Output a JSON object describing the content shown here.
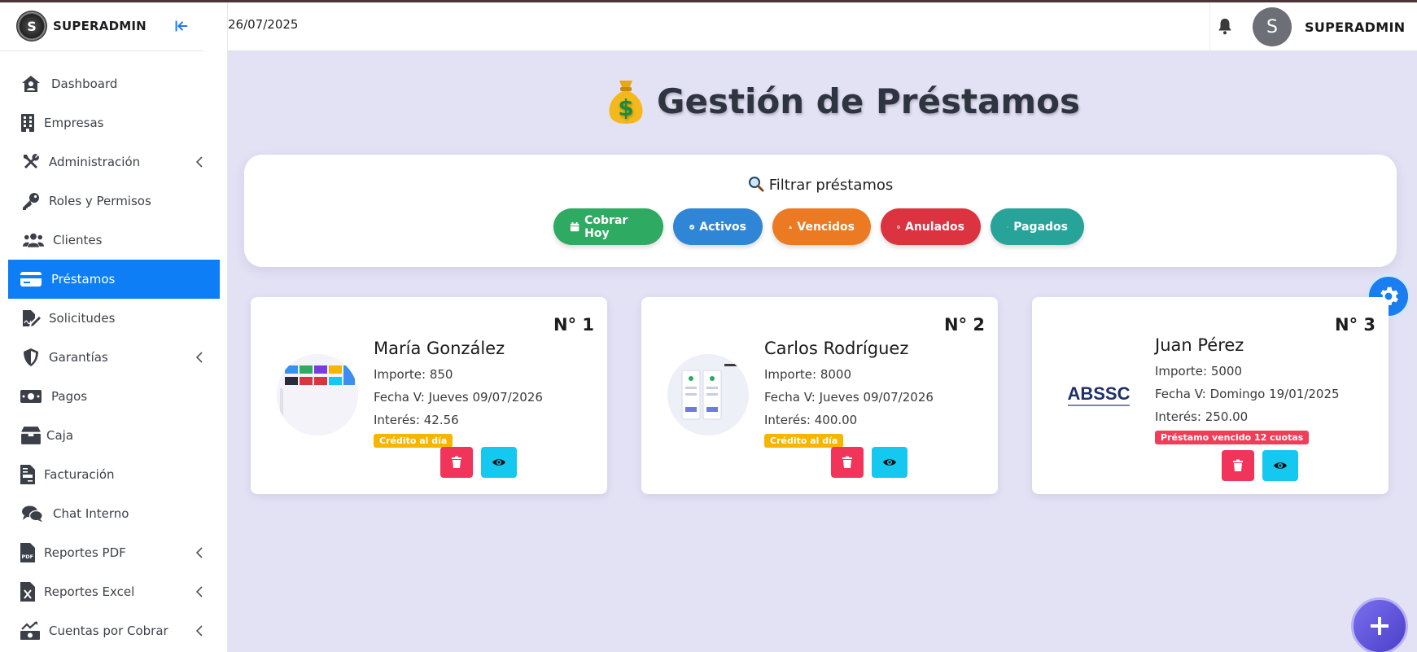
{
  "app": {
    "brand_name": "SUPERADMIN",
    "brand_initial": "S"
  },
  "topbar": {
    "date": "26/07/2025",
    "user_initial": "S",
    "user_name": "SUPERADMIN"
  },
  "sidebar": {
    "items": [
      {
        "label": "Dashboard",
        "icon": "house-user-icon",
        "has_chevron": false
      },
      {
        "label": "Empresas",
        "icon": "building-icon",
        "has_chevron": false
      },
      {
        "label": "Administración",
        "icon": "tools-icon",
        "has_chevron": true
      },
      {
        "label": "Roles y Permisos",
        "icon": "key-icon",
        "has_chevron": false
      },
      {
        "label": "Clientes",
        "icon": "users-icon",
        "has_chevron": false
      },
      {
        "label": "Préstamos",
        "icon": "credit-card-icon",
        "has_chevron": false,
        "active": true
      },
      {
        "label": "Solicitudes",
        "icon": "file-signature-icon",
        "has_chevron": false
      },
      {
        "label": "Garantías",
        "icon": "shield-icon",
        "has_chevron": true
      },
      {
        "label": "Pagos",
        "icon": "money-bill-icon",
        "has_chevron": false
      },
      {
        "label": "Caja",
        "icon": "box-icon",
        "has_chevron": false
      },
      {
        "label": "Facturación",
        "icon": "invoice-icon",
        "has_chevron": false
      },
      {
        "label": "Chat Interno",
        "icon": "comments-icon",
        "has_chevron": false
      },
      {
        "label": "Reportes PDF",
        "icon": "file-pdf-icon",
        "has_chevron": true
      },
      {
        "label": "Reportes Excel",
        "icon": "file-excel-icon",
        "has_chevron": true
      },
      {
        "label": "Cuentas por Cobrar",
        "icon": "money-chart-icon",
        "has_chevron": true
      }
    ]
  },
  "main": {
    "title": "Gestión de Préstamos",
    "title_icon": "money-bag-icon",
    "filter": {
      "title": "Filtrar préstamos",
      "buttons": [
        {
          "label": "Cobrar Hoy",
          "color": "#2faa62",
          "icon": "calendar-icon"
        },
        {
          "label": "Activos",
          "color": "#2f86d6",
          "icon": "check-circle-icon"
        },
        {
          "label": "Vencidos",
          "color": "#ec7a22",
          "icon": "warning-icon"
        },
        {
          "label": "Anulados",
          "color": "#dc3340",
          "icon": "ban-icon"
        },
        {
          "label": "Pagados",
          "color": "#27a39a",
          "icon": "double-check-icon"
        }
      ]
    },
    "loans": [
      {
        "number": "N° 1",
        "name": "María González",
        "amount": "Importe: 850",
        "due": "Fecha V: Jueves 09/07/2026",
        "interest": "Interés: 42.56",
        "badge": "Crédito al día",
        "badge_type": "ok"
      },
      {
        "number": "N° 2",
        "name": "Carlos Rodríguez",
        "amount": "Importe: 8000",
        "due": "Fecha V: Jueves 09/07/2026",
        "interest": "Interés: 400.00",
        "badge": "Crédito al día",
        "badge_type": "ok"
      },
      {
        "number": "N° 3",
        "name": "Juan Pérez",
        "amount": "Importe: 5000",
        "due": "Fecha V: Domingo 19/01/2025",
        "interest": "Interés: 250.00",
        "badge": "Préstamo vencido 12 cuotas",
        "badge_type": "bad",
        "thumb_text": "ABSSC"
      }
    ]
  }
}
